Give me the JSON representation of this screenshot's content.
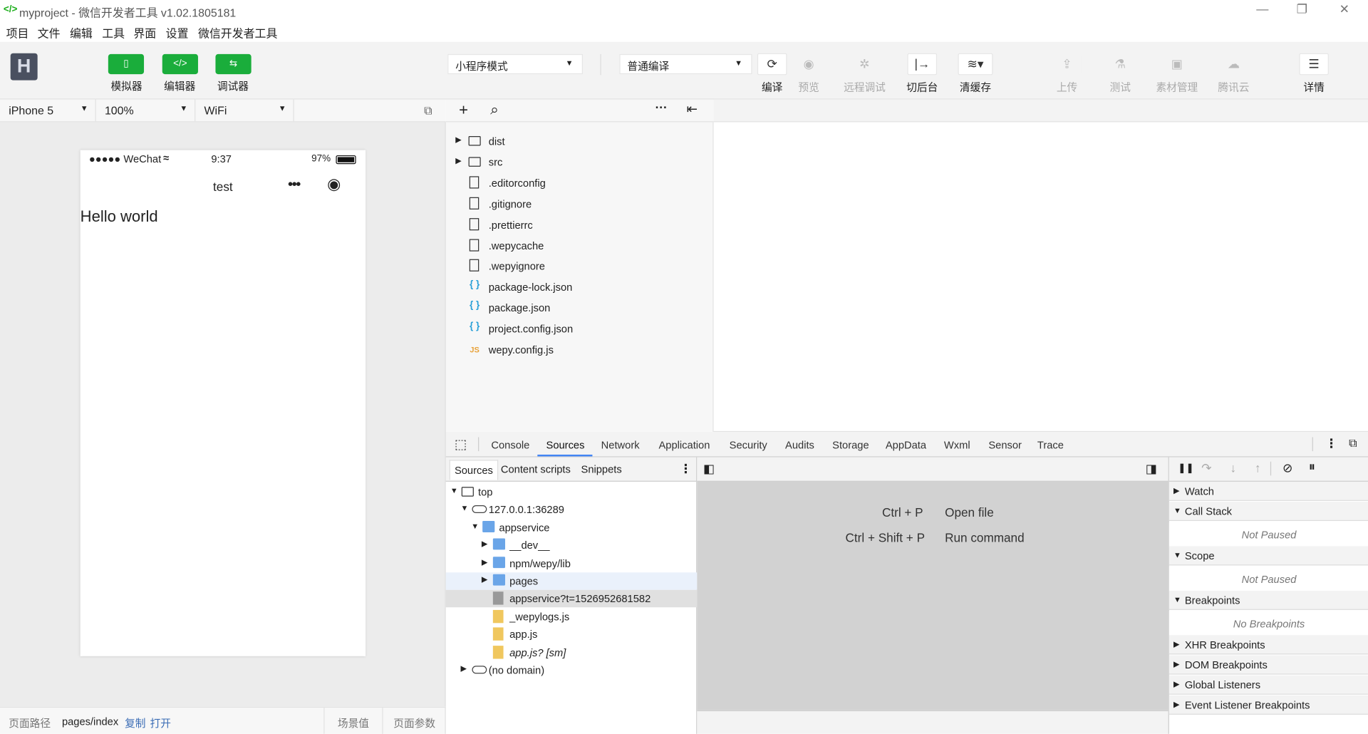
{
  "window": {
    "title": "myproject - 微信开发者工具 v1.02.1805181",
    "minimize_glyph": "—",
    "restore_glyph": "❐",
    "close_glyph": "✕"
  },
  "menu": [
    "项目",
    "文件",
    "编辑",
    "工具",
    "界面",
    "设置",
    "微信开发者工具"
  ],
  "toolbar": {
    "logo_glyph": "H",
    "simulator_label": "模拟器",
    "editor_label": "编辑器",
    "debugger_label": "调试器",
    "editor_glyph": "</>",
    "mode_select": "小程序模式",
    "compile_select": "普通编译",
    "compile_label": "编译",
    "preview_label": "预览",
    "remote_debug_label": "远程调试",
    "background_label": "切后台",
    "clear_cache_label": "清缓存",
    "upload_label": "上传",
    "test_label": "测试",
    "assets_label": "素材管理",
    "tencent_cloud_label": "腾讯云",
    "details_label": "详情",
    "refresh_glyph": "⟳",
    "eye_glyph": "◉",
    "bug_glyph": "✲",
    "switch_glyph": "|→",
    "layers_glyph": "≋▾",
    "upload_glyph": "⇪",
    "test_glyph": "⚗",
    "assets_glyph": "▣",
    "cloud_glyph": "☁",
    "menu_glyph": "☰"
  },
  "device_bar": {
    "device": "iPhone 5",
    "zoom": "100%",
    "network": "WiFi",
    "detach_glyph": "⧉"
  },
  "phone": {
    "signal": "●●●●● WeChat",
    "wifi_glyph": "≈",
    "time": "9:37",
    "battery": "97%",
    "nav_title": "test",
    "more_glyph": "•••",
    "record_glyph": "◉",
    "content": "Hello world"
  },
  "path_bar": {
    "label": "页面路径",
    "path": "pages/index",
    "copy": "复制",
    "open": "打开",
    "scene": "场景值",
    "params": "页面参数"
  },
  "file_toolbar": {
    "add_glyph": "+",
    "search_glyph": "⌕",
    "more_glyph": "···",
    "collapse_glyph": "⇤"
  },
  "files": [
    {
      "name": "dist",
      "type": "folder"
    },
    {
      "name": "src",
      "type": "folder"
    },
    {
      "name": ".editorconfig",
      "type": "file"
    },
    {
      "name": ".gitignore",
      "type": "file"
    },
    {
      "name": ".prettierrc",
      "type": "file"
    },
    {
      "name": ".wepycache",
      "type": "file"
    },
    {
      "name": ".wepyignore",
      "type": "file"
    },
    {
      "name": "package-lock.json",
      "type": "json"
    },
    {
      "name": "package.json",
      "type": "json"
    },
    {
      "name": "project.config.json",
      "type": "json"
    },
    {
      "name": "wepy.config.js",
      "type": "js"
    }
  ],
  "file_icons": {
    "json": "{ }",
    "js": "JS"
  },
  "devtools": {
    "inspect_glyph": "⬚",
    "tabs": [
      "Console",
      "Sources",
      "Network",
      "Application",
      "Security",
      "Audits",
      "Storage",
      "AppData",
      "Wxml",
      "Sensor",
      "Trace"
    ],
    "active_tab": "Sources",
    "more_glyph": "⋮",
    "undock_glyph": "⧉",
    "accent_color": "#4285f4"
  },
  "sources": {
    "subtabs": [
      "Sources",
      "Content scripts",
      "Snippets"
    ],
    "subtabs_more_glyph": "⋮",
    "toggle_nav_glyph": "◧",
    "toggle_debug_glyph": "◨",
    "tree": [
      {
        "name": "top",
        "depth": 0,
        "arrow": "▼",
        "icon": "box"
      },
      {
        "name": "127.0.0.1:36289",
        "depth": 1,
        "arrow": "▼",
        "icon": "cloud"
      },
      {
        "name": "appservice",
        "depth": 2,
        "arrow": "▼",
        "icon": "folder"
      },
      {
        "name": "__dev__",
        "depth": 3,
        "arrow": "▶",
        "icon": "folder"
      },
      {
        "name": "npm/wepy/lib",
        "depth": 3,
        "arrow": "▶",
        "icon": "folder"
      },
      {
        "name": "pages",
        "depth": 3,
        "arrow": "▶",
        "icon": "folder",
        "hover": true
      },
      {
        "name": "appservice?t=1526952681582",
        "depth": 3,
        "arrow": "",
        "icon": "gray",
        "selected": true
      },
      {
        "name": "_wepylogs.js",
        "depth": 3,
        "arrow": "",
        "icon": "yellow"
      },
      {
        "name": "app.js",
        "depth": 3,
        "arrow": "",
        "icon": "yellow"
      },
      {
        "name": "app.js? [sm]",
        "depth": 3,
        "arrow": "",
        "icon": "yellow",
        "italic": true
      },
      {
        "name": "(no domain)",
        "depth": 1,
        "arrow": "▶",
        "icon": "cloud"
      }
    ],
    "shortcuts": [
      {
        "keys": "Ctrl + P",
        "action": "Open file"
      },
      {
        "keys": "Ctrl + Shift + P",
        "action": "Run command"
      }
    ]
  },
  "debugger": {
    "controls": [
      "❚❚",
      "↷",
      "↓",
      "↑",
      "⊘",
      "⏸"
    ],
    "sections": [
      {
        "name": "Watch",
        "arrow": "▶"
      },
      {
        "name": "Call Stack",
        "arrow": "▼",
        "message": "Not Paused"
      },
      {
        "name": "Scope",
        "arrow": "▼",
        "message": "Not Paused"
      },
      {
        "name": "Breakpoints",
        "arrow": "▼",
        "message": "No Breakpoints"
      },
      {
        "name": "XHR Breakpoints",
        "arrow": "▶"
      },
      {
        "name": "DOM Breakpoints",
        "arrow": "▶"
      },
      {
        "name": "Global Listeners",
        "arrow": "▶"
      },
      {
        "name": "Event Listener Breakpoints",
        "arrow": "▶"
      }
    ]
  }
}
